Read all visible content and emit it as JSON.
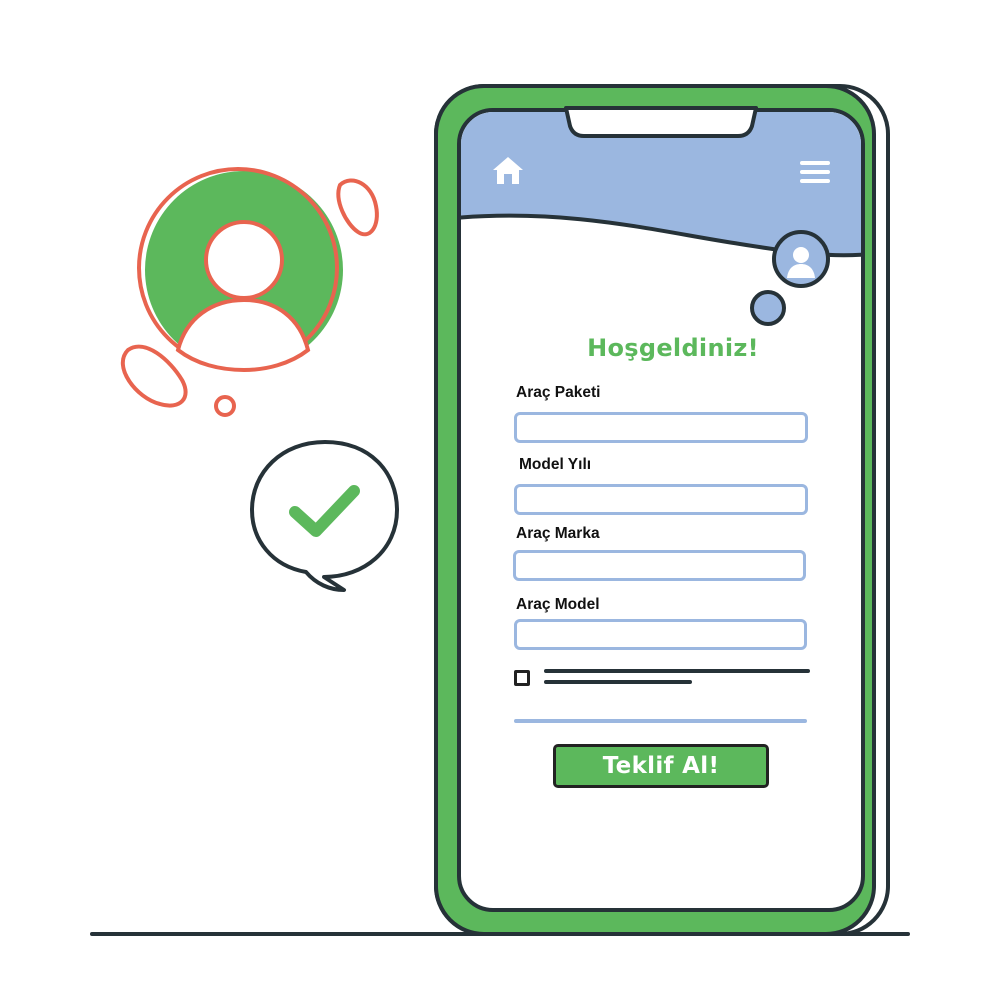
{
  "screen": {
    "title": "Hoşgeldiniz!",
    "fields": [
      {
        "label": "Araç Paketi",
        "value": "",
        "placeholder": ""
      },
      {
        "label": "Model Yılı",
        "value": "",
        "placeholder": ""
      },
      {
        "label": "Araç Marka",
        "value": "",
        "placeholder": ""
      },
      {
        "label": "Araç Model",
        "value": "",
        "placeholder": ""
      }
    ],
    "submit_label": "Teklif Al!"
  },
  "icons": {
    "home": "home-icon",
    "menu": "hamburger-menu-icon",
    "avatar": "user-avatar-icon",
    "large_avatar": "user-profile-icon",
    "check": "checkmark-speech-bubble-icon"
  },
  "colors": {
    "green": "#5cb85c",
    "blue": "#9bb7e0",
    "coral": "#e8644f",
    "outline": "#263238"
  }
}
